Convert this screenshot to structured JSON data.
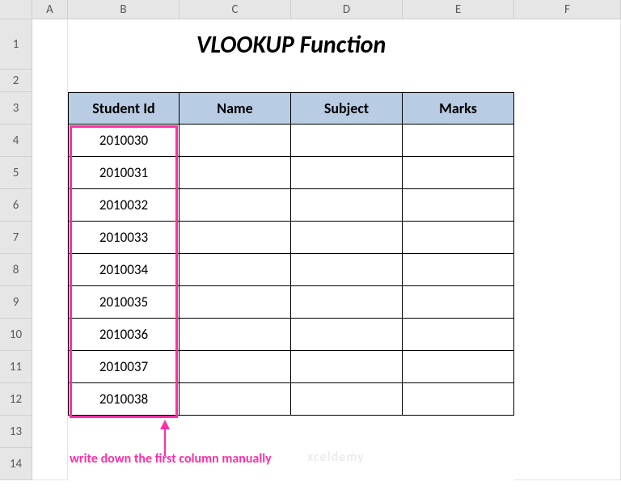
{
  "columns": [
    "A",
    "B",
    "C",
    "D",
    "E",
    "F"
  ],
  "rows": [
    "1",
    "2",
    "3",
    "4",
    "5",
    "6",
    "7",
    "8",
    "9",
    "10",
    "11",
    "12",
    "13",
    "14"
  ],
  "title": "VLOOKUP Function",
  "headers": {
    "student_id": "Student Id",
    "name": "Name",
    "subject": "Subject",
    "marks": "Marks"
  },
  "data": {
    "student_id": [
      "2010030",
      "2010031",
      "2010032",
      "2010033",
      "2010034",
      "2010035",
      "2010036",
      "2010037",
      "2010038"
    ]
  },
  "annotation": "write down the first column manually",
  "watermark": "xceldemy",
  "chart_data": {
    "type": "table",
    "title": "VLOOKUP Function",
    "columns": [
      "Student Id",
      "Name",
      "Subject",
      "Marks"
    ],
    "rows": [
      [
        "2010030",
        "",
        "",
        ""
      ],
      [
        "2010031",
        "",
        "",
        ""
      ],
      [
        "2010032",
        "",
        "",
        ""
      ],
      [
        "2010033",
        "",
        "",
        ""
      ],
      [
        "2010034",
        "",
        "",
        ""
      ],
      [
        "2010035",
        "",
        "",
        ""
      ],
      [
        "2010036",
        "",
        "",
        ""
      ],
      [
        "2010037",
        "",
        "",
        ""
      ],
      [
        "2010038",
        "",
        "",
        ""
      ]
    ]
  }
}
